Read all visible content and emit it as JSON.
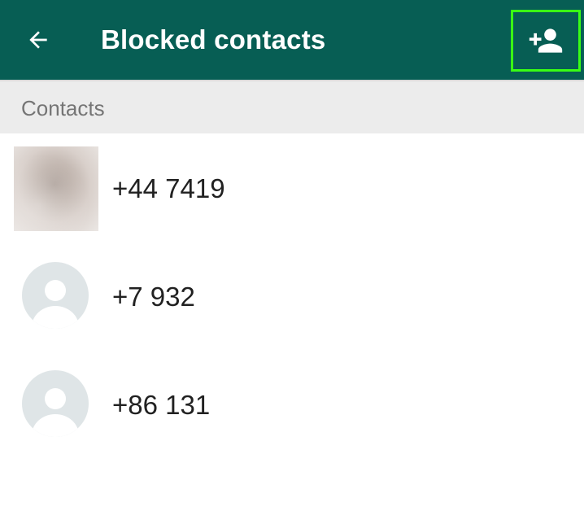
{
  "colors": {
    "appbar": "#075e54",
    "highlight": "#39ff14",
    "section_bg": "#ececec",
    "avatar_bg": "#dfe5e7"
  },
  "appbar": {
    "back_icon": "arrow-left-icon",
    "title": "Blocked contacts",
    "add_icon": "person-add-icon"
  },
  "section": {
    "label": "Contacts"
  },
  "contacts": [
    {
      "number": "+44 7419",
      "avatar": "photo"
    },
    {
      "number": "+7 932",
      "avatar": "default-person-icon"
    },
    {
      "number": "+86 131",
      "avatar": "default-person-icon"
    }
  ]
}
